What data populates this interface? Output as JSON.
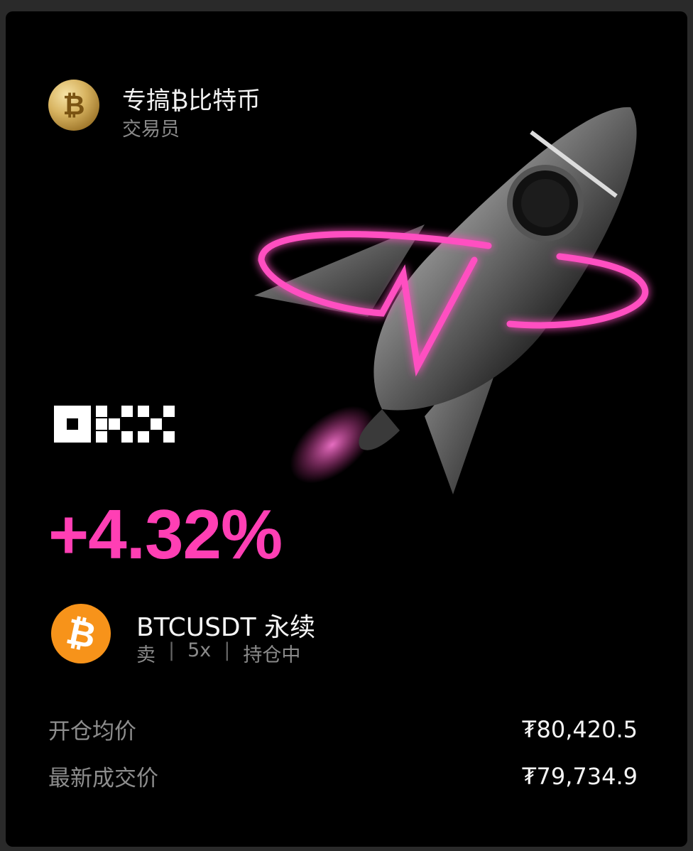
{
  "trader": {
    "avatar_icon": "bitcoin-gold-coin-icon",
    "avatar_glyph": "₿",
    "name": "专搞₿比特币",
    "role": "交易员"
  },
  "brand": {
    "logo_icon": "okx-logo"
  },
  "hero": {
    "image": "rocket-with-pink-neon-ring"
  },
  "position": {
    "pnl_percent": "+4.32%",
    "coin_icon": "bitcoin-icon",
    "coin_glyph": "₿",
    "pair": "BTCUSDT 永续",
    "side": "卖",
    "leverage": "5x",
    "status": "持仓中",
    "separator": "|"
  },
  "prices": [
    {
      "label": "开仓均价",
      "value": "₮80,420.5"
    },
    {
      "label": "最新成交价",
      "value": "₮79,734.9"
    }
  ],
  "colors": {
    "background": "#000000",
    "accent": "#ff3fb4",
    "bitcoin": "#f7931a"
  }
}
